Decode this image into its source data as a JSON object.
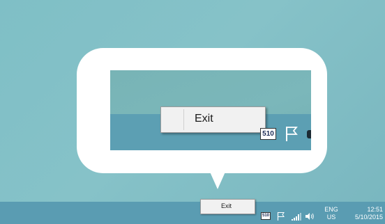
{
  "callout": {
    "zoom_menu": {
      "item_label": "Exit"
    },
    "zoom_tray": {
      "app_icon_text": "510"
    }
  },
  "context_menu": {
    "item_label": "Exit"
  },
  "tray": {
    "app_icon_text": "510",
    "language": {
      "line1": "ENG",
      "line2": "US"
    },
    "clock": {
      "time": "12:51",
      "date": "5/10/2015"
    },
    "icons": [
      "s10-app-icon",
      "action-center-flag-icon",
      "network-signal-icon",
      "volume-icon"
    ]
  },
  "colors": {
    "taskbar": "#5a9cb2",
    "desktop": "#7fbfc6",
    "menu_background": "#f1f1f1",
    "callout": "#ffffff"
  }
}
